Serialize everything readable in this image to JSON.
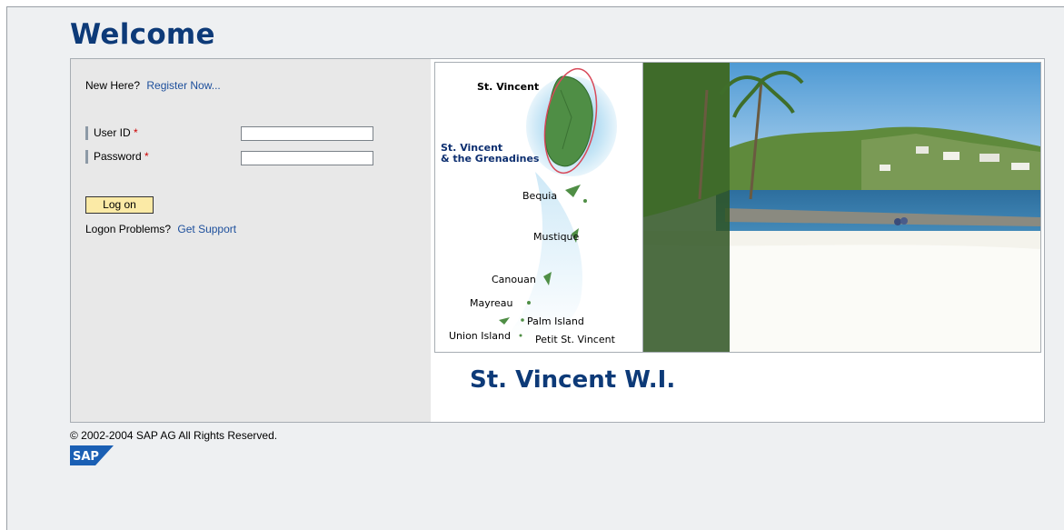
{
  "page": {
    "welcome_title": "Welcome"
  },
  "login": {
    "new_here": "New Here?",
    "register_link": "Register Now...",
    "user_id_label": "User ID",
    "password_label": "Password",
    "required_mark": "*",
    "user_id_value": "",
    "password_value": "",
    "logon_button": "Log on",
    "logon_problems": "Logon Problems?",
    "get_support_link": "Get Support"
  },
  "map": {
    "labels": {
      "st_vincent": "St. Vincent",
      "country_line1": "St. Vincent",
      "country_line2": "& the Grenadines",
      "bequia": "Bequia",
      "mustique": "Mustique",
      "canouan": "Canouan",
      "mayreau": "Mayreau",
      "palm_island": "Palm Island",
      "union_island": "Union Island",
      "petit_st_vincent": "Petit St. Vincent"
    }
  },
  "caption": "St. Vincent W.I.",
  "footer": {
    "copyright": "© 2002-2004 SAP AG All Rights Reserved.",
    "logo_text": "SAP"
  },
  "colors": {
    "brand_blue": "#0d3a78",
    "link": "#1d4f9c",
    "button": "#fbeaa6",
    "required": "#cc0000"
  }
}
